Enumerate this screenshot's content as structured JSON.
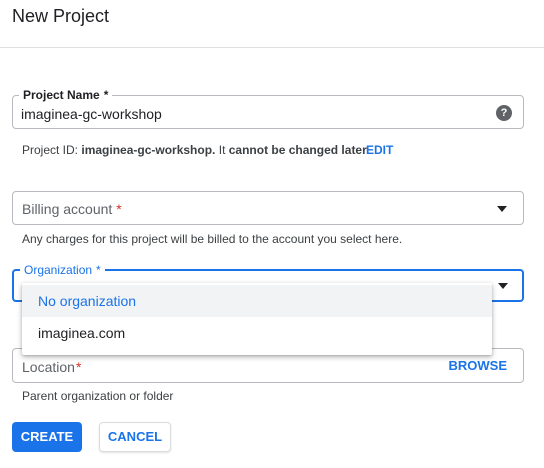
{
  "header": {
    "title": "New Project"
  },
  "project_name": {
    "label": "Project Name",
    "required_mark": "*",
    "value": "imaginea-gc-workshop",
    "help_icon": "help-icon",
    "id_prefix": "Project ID:",
    "id_value": "imaginea-gc-workshop.",
    "id_suffix": "It",
    "id_note": "cannot be changed later.",
    "edit_label": "EDIT"
  },
  "billing": {
    "placeholder": "Billing account",
    "required_mark": "*",
    "hint": "Any charges for this project will be billed to the account you select here."
  },
  "organization": {
    "label": "Organization",
    "required_mark": "*",
    "options": [
      "No organization",
      "imaginea.com"
    ],
    "selected": "No organization"
  },
  "location": {
    "placeholder": "Location",
    "required_mark": "*",
    "browse_label": "BROWSE",
    "hint": "Parent organization or folder"
  },
  "actions": {
    "create_label": "CREATE",
    "cancel_label": "CANCEL"
  },
  "colors": {
    "accent": "#1a73e8",
    "required": "#d93025"
  }
}
